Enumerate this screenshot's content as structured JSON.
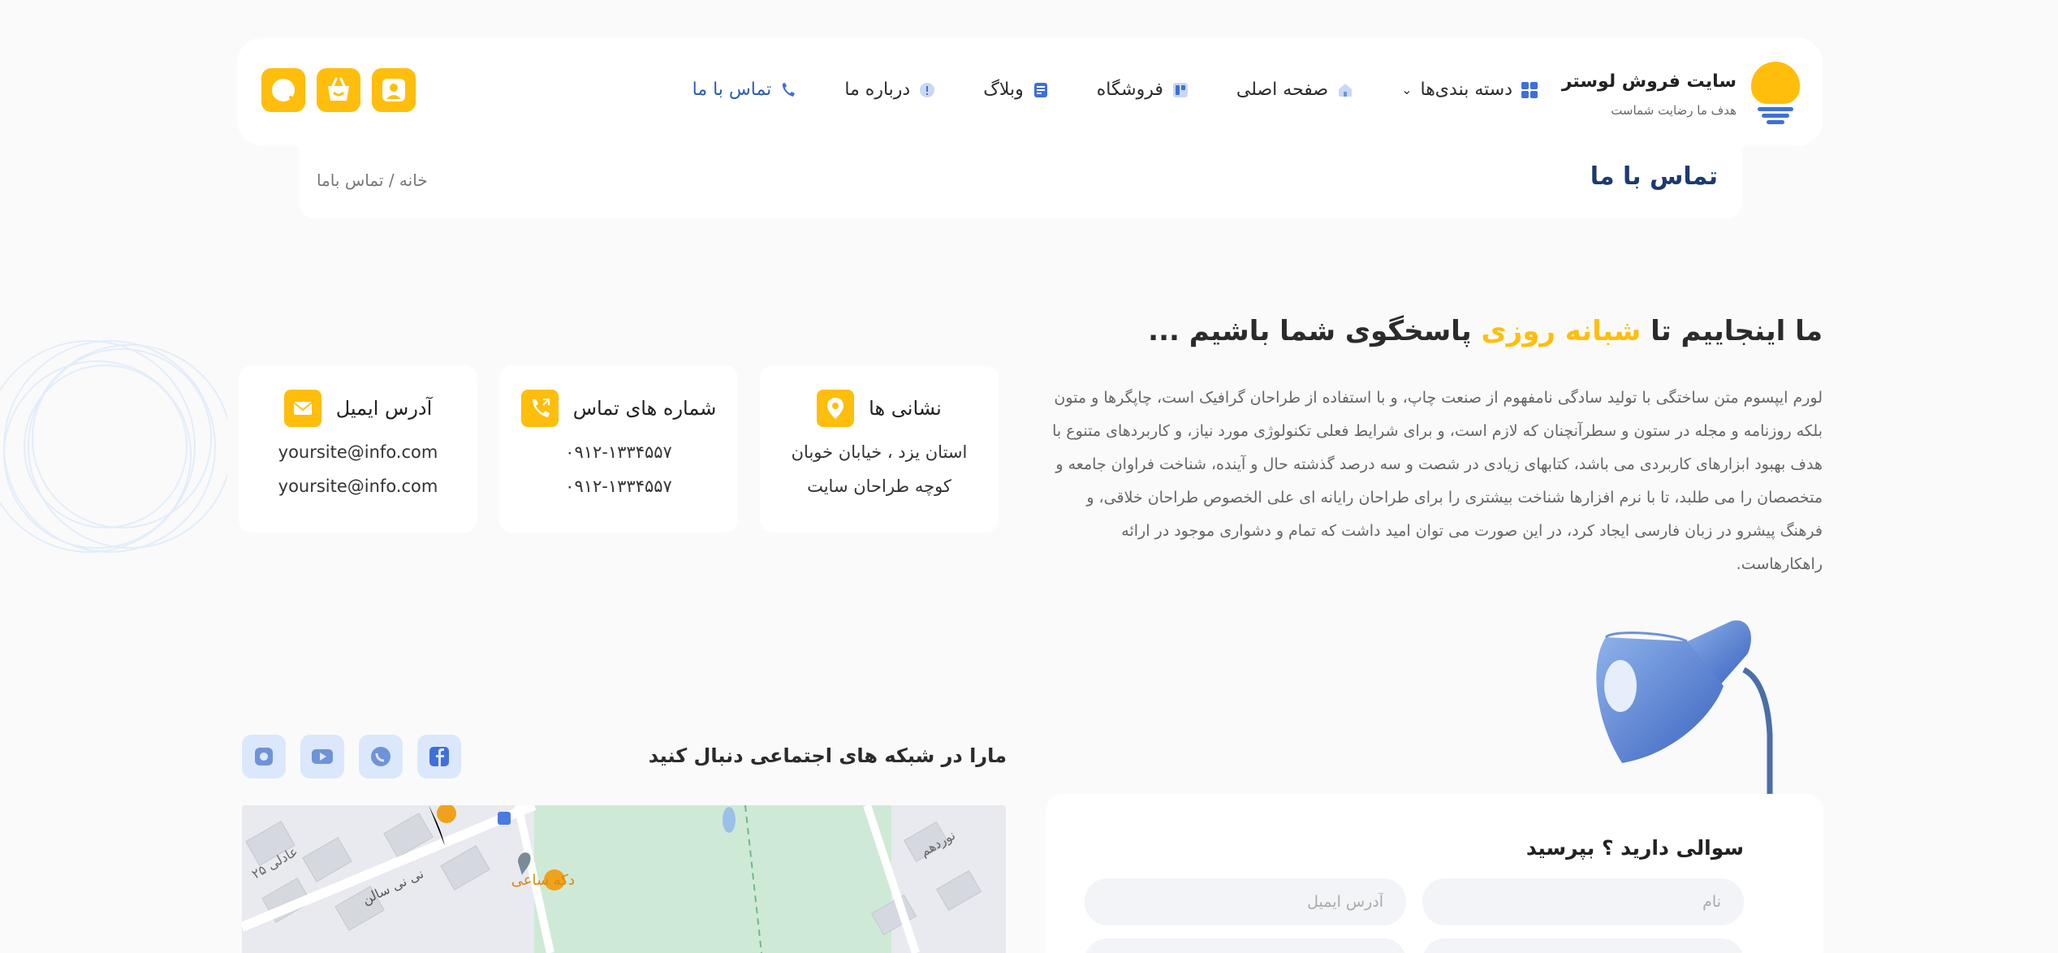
{
  "header": {
    "brand_title": "سایت فروش لوستر",
    "brand_sub": "هدف ما رضایت شماست",
    "nav": [
      {
        "label": "دسته بندی‌ها",
        "icon": "grid-icon",
        "has_dropdown": true
      },
      {
        "label": "صفحه اصلی",
        "icon": "home-icon"
      },
      {
        "label": "فروشگاه",
        "icon": "store-icon"
      },
      {
        "label": "وبلاگ",
        "icon": "blog-icon"
      },
      {
        "label": "درباره ما",
        "icon": "info-icon"
      },
      {
        "label": "تماس با ما",
        "icon": "phone-icon",
        "active": true
      }
    ],
    "buttons": [
      "search-icon",
      "basket-icon",
      "user-icon"
    ]
  },
  "breadcrumb": {
    "title": "تماس با ما",
    "path": "خانه / تماس باما"
  },
  "intro": {
    "title_pre": "ما اینجاییم تا ",
    "title_highlight": "شبانه روزی",
    "title_post": " پاسخگوی شما باشیم ...",
    "body": "لورم ایپسوم متن ساختگی با تولید سادگی نامفهوم از صنعت چاپ، و با استفاده از طراحان گرافیک است، چاپگرها و متون بلکه روزنامه و مجله در ستون و سطرآنچنان که لازم است، و برای شرایط فعلی تکنولوژی مورد نیاز، و کاربردهای متنوع با هدف بهبود ابزارهای کاربردی می باشد، کتابهای زیادی در شصت و سه درصد گذشته حال و آینده، شناخت فراوان جامعه و متخصصان را می طلبد، تا با نرم افزارها شناخت بیشتری را برای طراحان رایانه ای علی الخصوص طراحان خلاقی، و فرهنگ پیشرو در زبان فارسی ایجاد کرد، در این صورت می توان امید داشت که تمام و دشواری موجود در ارائه راهکارهاست."
  },
  "cards": {
    "address": {
      "title": "نشانی ها",
      "icon": "location-icon",
      "lines": [
        "استان یزد ، خیابان خوبان",
        "کوچه طراحان سایت"
      ]
    },
    "phone": {
      "title": "شماره های تماس",
      "icon": "phone-call-icon",
      "lines": [
        "۰۹۱۲-۱۳۳۴۵۵۷",
        "۰۹۱۲-۱۳۳۴۵۵۷"
      ]
    },
    "email": {
      "title": "آدرس ایمیل",
      "icon": "mail-icon",
      "lines": [
        "yoursite@info.com",
        "yoursite@info.com"
      ]
    }
  },
  "social": {
    "title": "مارا در شبکه های اجتماعی دنبال کنید",
    "icons": [
      "instagram-icon",
      "youtube-icon",
      "whatsapp-icon",
      "facebook-icon"
    ]
  },
  "map": {
    "labels": [
      "دکه ساعی",
      "نی نی سالن",
      "عادلی ۲۵",
      "نوردهم"
    ]
  },
  "form": {
    "title": "سوالی دارید ؟ بپرسید",
    "name_placeholder": "نام",
    "email_placeholder": "آدرس ایمیل"
  },
  "colors": {
    "accent": "#ffbe0b",
    "primary": "#2a5db0",
    "title": "#1c3a6e"
  }
}
